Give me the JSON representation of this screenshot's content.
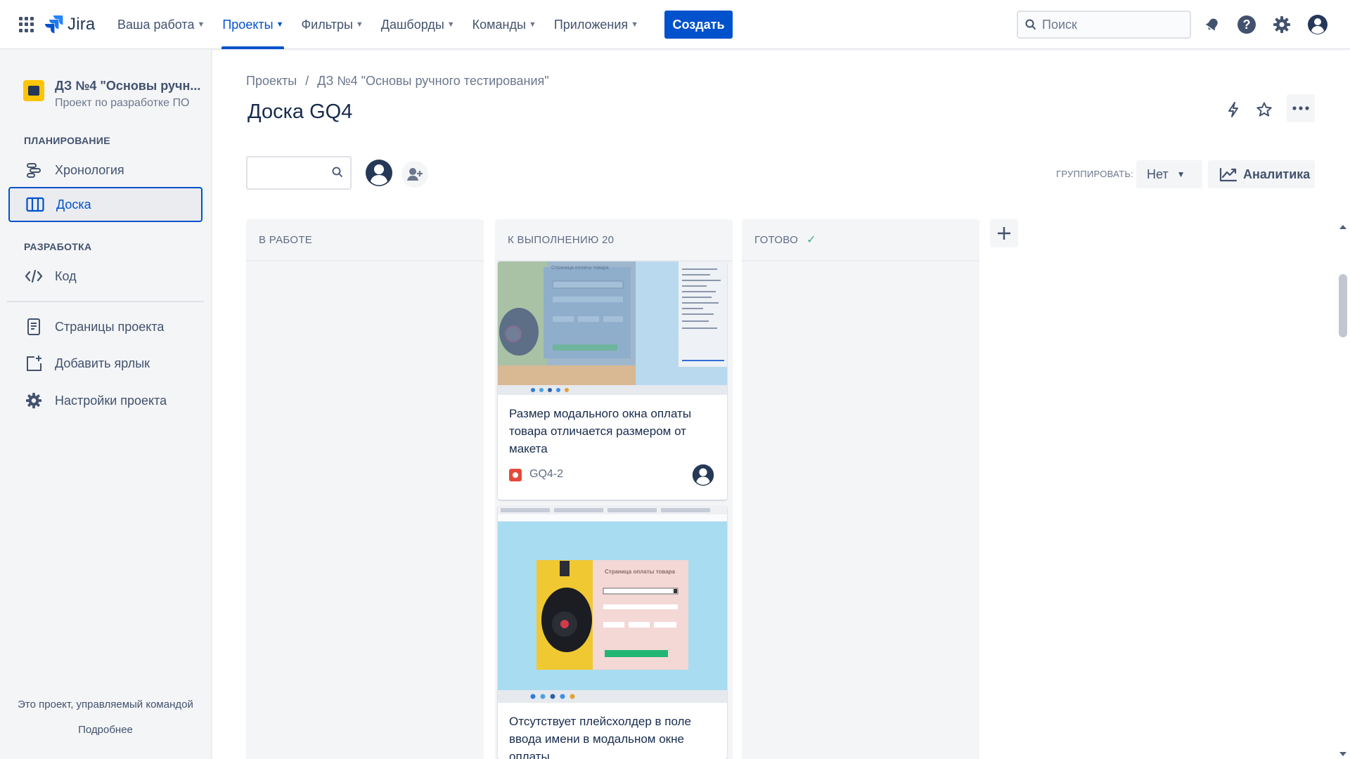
{
  "topnav": {
    "logo_text": "Jira",
    "menu": [
      {
        "label": "Ваша работа",
        "active": false
      },
      {
        "label": "Проекты",
        "active": true
      },
      {
        "label": "Фильтры",
        "active": false
      },
      {
        "label": "Дашборды",
        "active": false
      },
      {
        "label": "Команды",
        "active": false
      },
      {
        "label": "Приложения",
        "active": false
      }
    ],
    "create_label": "Создать",
    "search_placeholder": "Поиск"
  },
  "sidebar": {
    "project_name": "ДЗ №4 \"Основы ручн...",
    "project_type": "Проект по разработке ПО",
    "planning_heading": "ПЛАНИРОВАНИЕ",
    "timeline_label": "Хронология",
    "board_label": "Доска",
    "dev_heading": "РАЗРАБОТКА",
    "code_label": "Код",
    "pages_label": "Страницы проекта",
    "shortcut_label": "Добавить ярлык",
    "settings_label": "Настройки проекта",
    "footer_text": "Это проект, управляемый командой",
    "footer_link": "Подробнее"
  },
  "breadcrumb": {
    "projects": "Проекты",
    "separator": "/",
    "project": "ДЗ №4 \"Основы ручного тестирования\""
  },
  "page_title": "Доска GQ4",
  "toolbar": {
    "group_label": "ГРУППИРОВАТЬ:",
    "group_value": "Нет",
    "insights_label": "Аналитика"
  },
  "columns": [
    {
      "title": "В РАБОТЕ",
      "done": false
    },
    {
      "title": "К ВЫПОЛНЕНИЮ 20",
      "done": false
    },
    {
      "title": "ГОТОВО",
      "done": true
    }
  ],
  "cards": [
    {
      "title": "Размер модального окна оплаты товара отличается размером от макета",
      "key": "GQ4-2",
      "thumb_text": "Страница оплаты товара"
    },
    {
      "title": "Отсутствует плейсхолдер в поле ввода имени в модальном окне оплаты...",
      "key": "",
      "thumb_text": "Страница оплаты товара"
    }
  ],
  "colors": {
    "accent": "#0052cc",
    "sidebar_bg": "#f4f5f7",
    "done_check": "#36b37e",
    "bug": "#e5493a"
  }
}
